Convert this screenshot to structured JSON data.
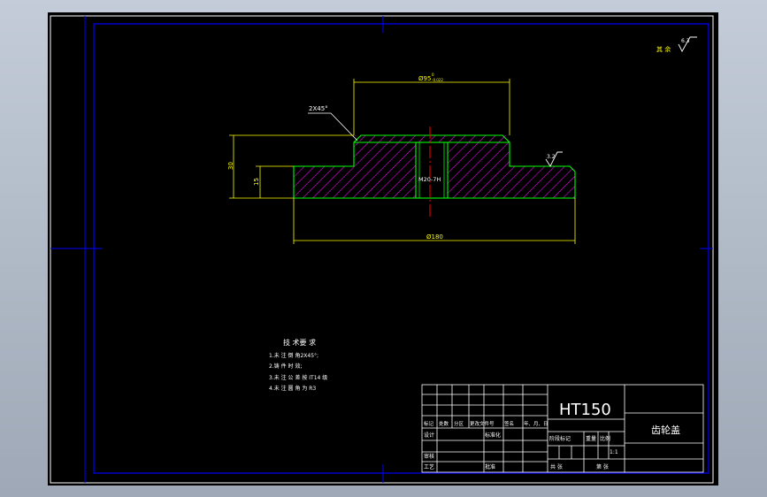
{
  "drawing": {
    "surface_finish_other": "其 余",
    "surface_finish_other_value": "6.3",
    "dim_top_diameter": "Ø95",
    "dim_top_tol_upper": "0",
    "dim_top_tol_lower": "-0.022",
    "dim_chamfer": "2X45°",
    "dim_height_total": "30",
    "dim_height_flange": "15",
    "dim_thread": "M20-7H",
    "dim_bottom_diameter": "Ø180",
    "surface_finish_flange": "3.2"
  },
  "tech_requirements": {
    "title": "技 术要 求",
    "items": [
      "1.未 注 倒 角2X45°;",
      "2.铸 件 时 效;",
      "3.未 注 公 差 按 IT14 级",
      "4.未 注 圆 角 为 R3"
    ]
  },
  "title_block": {
    "material": "HT150",
    "part_name": "齿轮盖",
    "row_labels": [
      "标记",
      "处数",
      "分区",
      "更改文件号",
      "签名",
      "年、月、日"
    ],
    "design": "设计",
    "standardize": "标准化",
    "stage_label": "阶段标记",
    "weight": "重量",
    "scale": "比例",
    "scale_value": "1:1",
    "review": "审核",
    "process": "工艺",
    "approve": "批准",
    "sheets_total": "共 张",
    "sheet_no": "第 张"
  },
  "colors": {
    "background": "#000000",
    "frame": "#0000ff",
    "outline": "#00ff00",
    "dimension": "#ffff00",
    "hatch": "#ff00ff",
    "centerline": "#ff0000",
    "text": "#ffffff"
  }
}
